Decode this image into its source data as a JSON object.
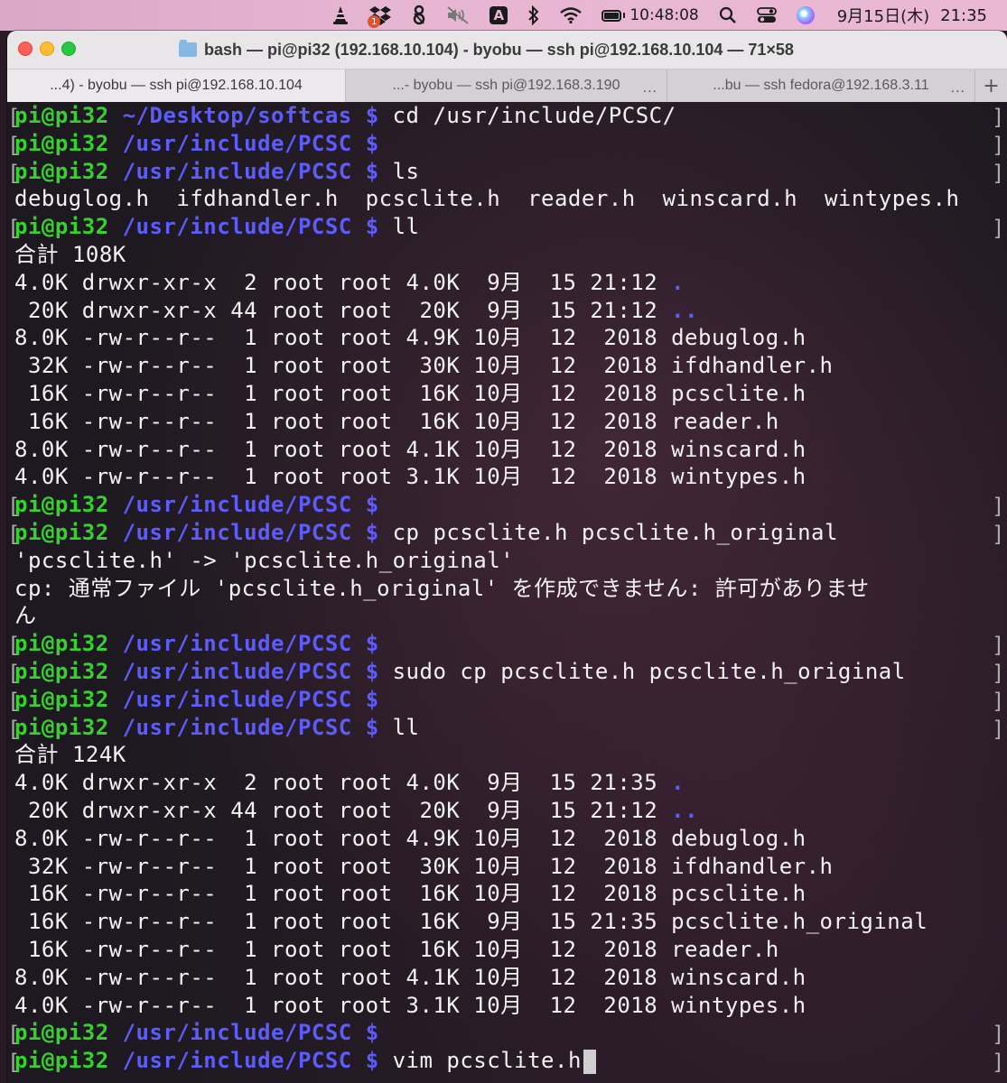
{
  "menubar": {
    "icons": [
      "vlc-icon",
      "dropbox-icon",
      "bartender-icon",
      "mute-icon",
      "input-source-icon",
      "bluetooth-icon",
      "wifi-icon",
      "battery-icon",
      "search-icon",
      "control-center-icon",
      "siri-icon"
    ],
    "input_source_label": "A",
    "dropbox_badge": "1",
    "battery_time": "10:48:08",
    "date": "9月15日(木)",
    "clock": "21:35"
  },
  "window": {
    "title": "bash — pi@pi32 (192.168.10.104) - byobu — ssh pi@192.168.10.104 — 71×58",
    "tabs": [
      {
        "label": "...4) - byobu — ssh pi@192.168.10.104",
        "active": true
      },
      {
        "label": "...- byobu — ssh pi@192.168.3.190",
        "active": false
      },
      {
        "label": "...bu — ssh fedora@192.168.3.11",
        "active": false
      }
    ],
    "tab_more": "...",
    "new_tab": "+"
  },
  "terminal": {
    "prompt_user": "pi@pi32",
    "lines": [
      {
        "type": "prompt",
        "path": "~/Desktop/softcas",
        "cmd": "cd /usr/include/PCSC/"
      },
      {
        "type": "prompt",
        "path": "/usr/include/PCSC",
        "cmd": ""
      },
      {
        "type": "prompt",
        "path": "/usr/include/PCSC",
        "cmd": "ls"
      },
      {
        "type": "out",
        "text": "debuglog.h  ifdhandler.h  pcsclite.h  reader.h  winscard.h  wintypes.h"
      },
      {
        "type": "prompt",
        "path": "/usr/include/PCSC",
        "cmd": "ll"
      },
      {
        "type": "out",
        "text": "合計 108K"
      },
      {
        "type": "out",
        "text": "4.0K drwxr-xr-x  2 root root 4.0K  9月  15 21:12 ",
        "dots": "."
      },
      {
        "type": "out",
        "text": " 20K drwxr-xr-x 44 root root  20K  9月  15 21:12 ",
        "dots": ".."
      },
      {
        "type": "out",
        "text": "8.0K -rw-r--r--  1 root root 4.9K 10月  12  2018 debuglog.h"
      },
      {
        "type": "out",
        "text": " 32K -rw-r--r--  1 root root  30K 10月  12  2018 ifdhandler.h"
      },
      {
        "type": "out",
        "text": " 16K -rw-r--r--  1 root root  16K 10月  12  2018 pcsclite.h"
      },
      {
        "type": "out",
        "text": " 16K -rw-r--r--  1 root root  16K 10月  12  2018 reader.h"
      },
      {
        "type": "out",
        "text": "8.0K -rw-r--r--  1 root root 4.1K 10月  12  2018 winscard.h"
      },
      {
        "type": "out",
        "text": "4.0K -rw-r--r--  1 root root 3.1K 10月  12  2018 wintypes.h"
      },
      {
        "type": "prompt",
        "path": "/usr/include/PCSC",
        "cmd": ""
      },
      {
        "type": "prompt",
        "path": "/usr/include/PCSC",
        "cmd": "cp pcsclite.h pcsclite.h_original"
      },
      {
        "type": "out",
        "text": "'pcsclite.h' -> 'pcsclite.h_original'"
      },
      {
        "type": "out",
        "text": "cp: 通常ファイル 'pcsclite.h_original' を作成できません: 許可がありませ"
      },
      {
        "type": "out",
        "text": "ん"
      },
      {
        "type": "prompt",
        "path": "/usr/include/PCSC",
        "cmd": ""
      },
      {
        "type": "prompt",
        "path": "/usr/include/PCSC",
        "cmd": "sudo cp pcsclite.h pcsclite.h_original"
      },
      {
        "type": "prompt",
        "path": "/usr/include/PCSC",
        "cmd": ""
      },
      {
        "type": "prompt",
        "path": "/usr/include/PCSC",
        "cmd": "ll"
      },
      {
        "type": "out",
        "text": "合計 124K"
      },
      {
        "type": "out",
        "text": "4.0K drwxr-xr-x  2 root root 4.0K  9月  15 21:35 ",
        "dots": "."
      },
      {
        "type": "out",
        "text": " 20K drwxr-xr-x 44 root root  20K  9月  15 21:12 ",
        "dots": ".."
      },
      {
        "type": "out",
        "text": "8.0K -rw-r--r--  1 root root 4.9K 10月  12  2018 debuglog.h"
      },
      {
        "type": "out",
        "text": " 32K -rw-r--r--  1 root root  30K 10月  12  2018 ifdhandler.h"
      },
      {
        "type": "out",
        "text": " 16K -rw-r--r--  1 root root  16K 10月  12  2018 pcsclite.h"
      },
      {
        "type": "out",
        "text": " 16K -rw-r--r--  1 root root  16K  9月  15 21:35 pcsclite.h_original"
      },
      {
        "type": "out",
        "text": " 16K -rw-r--r--  1 root root  16K 10月  12  2018 reader.h"
      },
      {
        "type": "out",
        "text": "8.0K -rw-r--r--  1 root root 4.1K 10月  12  2018 winscard.h"
      },
      {
        "type": "out",
        "text": "4.0K -rw-r--r--  1 root root 3.1K 10月  12  2018 wintypes.h"
      },
      {
        "type": "prompt",
        "path": "/usr/include/PCSC",
        "cmd": ""
      },
      {
        "type": "prompt",
        "path": "/usr/include/PCSC",
        "cmd": "vim pcsclite.h",
        "cursor": true
      }
    ]
  },
  "colors": {
    "prompt_user": "#36d12f",
    "prompt_path": "#5c5cff",
    "output_text": "#f2f2f2"
  }
}
